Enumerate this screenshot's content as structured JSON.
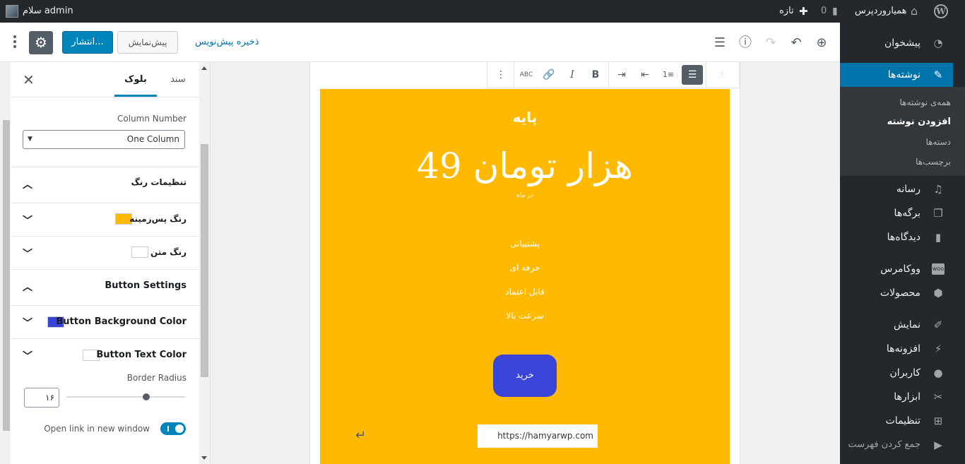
{
  "admin_bar": {
    "greeting": "سلام admin",
    "site_name": "همیاروردپرس",
    "comments_count": "0",
    "new_label": "تازه"
  },
  "admin_menu": {
    "items": [
      {
        "label": "پیشخوان",
        "icon": "dashboard-icon"
      },
      {
        "label": "نوشته‌ها",
        "icon": "pin-icon"
      },
      {
        "label": "رسانه",
        "icon": "media-icon"
      },
      {
        "label": "برگه‌ها",
        "icon": "pages-icon"
      },
      {
        "label": "دیدگاه‌ها",
        "icon": "comments-icon"
      },
      {
        "label": "ووکامرس",
        "icon": "woo-icon"
      },
      {
        "label": "محصولات",
        "icon": "products-icon"
      },
      {
        "label": "نمایش",
        "icon": "appearance-icon"
      },
      {
        "label": "افزونه‌ها",
        "icon": "plugins-icon"
      },
      {
        "label": "کاربران",
        "icon": "users-icon"
      },
      {
        "label": "ابزارها",
        "icon": "tools-icon"
      },
      {
        "label": "تنظیمات",
        "icon": "settings-icon"
      },
      {
        "label": "جمع کردن فهرست",
        "icon": "collapse-icon"
      }
    ],
    "submenu": [
      "همه‌ی نوشته‌ها",
      "افزودن نوشته",
      "دسته‌ها",
      "برچسب‌ها"
    ]
  },
  "header": {
    "publish_label": "انتشار...",
    "preview_label": "پیش‌نمایش",
    "save_draft_label": "ذخیره پیش‌نویس"
  },
  "sidebar": {
    "tab_document": "سند",
    "tab_block": "بلوک",
    "column_number_label": "Column Number",
    "column_number_value": "One Column",
    "color_settings": "تنظیمات رنگ",
    "bg_color_label": "رنگ پس‌زمینه",
    "bg_color": "#ffb900",
    "text_color_label": "رنگ متن",
    "text_color": "#ffffff",
    "button_settings": "Button Settings",
    "btn_bg_label": "Button Background Color",
    "btn_bg_color": "#3a44d8",
    "btn_text_label": "Button Text Color",
    "btn_text_color": "#ffffff",
    "border_radius_label": "Border Radius",
    "border_radius_value": "۱۶",
    "open_new_window_label": "Open link in new window"
  },
  "pricing_block": {
    "title": "پایه",
    "price": "49 هزار تومان",
    "period": "در ماه",
    "features": [
      "پشتیبانی",
      "حرفه ای",
      "قابل اعتماد",
      "سرعت بالا"
    ],
    "button_label": "خرید",
    "url": "https://hamyarwp.com"
  }
}
